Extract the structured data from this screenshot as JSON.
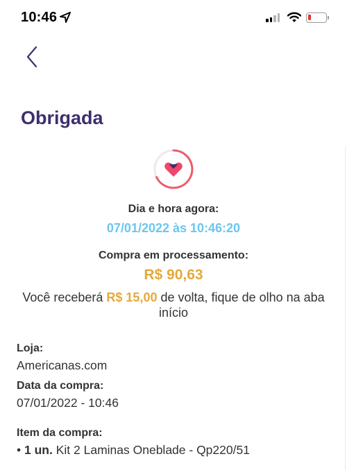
{
  "status_bar": {
    "time": "10:46"
  },
  "header": {
    "title": "Obrigada"
  },
  "summary": {
    "datetime_label": "Dia e hora agora:",
    "datetime_value": "07/01/2022 às 10:46:20",
    "processing_label": "Compra em processamento:",
    "amount": "R$ 90,63",
    "cashback_prefix": "Você receberá",
    "cashback_amount": "R$ 15,00",
    "cashback_suffix": "de volta, fique de olho na aba início"
  },
  "details": {
    "store_label": "Loja:",
    "store_value": "Americanas.com",
    "date_label": "Data da compra:",
    "date_value": "07/01/2022 - 10:46",
    "item_label": "Item da compra:",
    "item_qty": "1 un.",
    "item_name": "Kit 2 Laminas Oneblade - Qp220/51"
  },
  "colors": {
    "title": "#3e2e6e",
    "datetime": "#6cc6ee",
    "amount": "#e4a93b",
    "heart": "#f0466a"
  },
  "icons": {
    "back": "chevron-left-icon",
    "status": "progress-heart-icon"
  }
}
